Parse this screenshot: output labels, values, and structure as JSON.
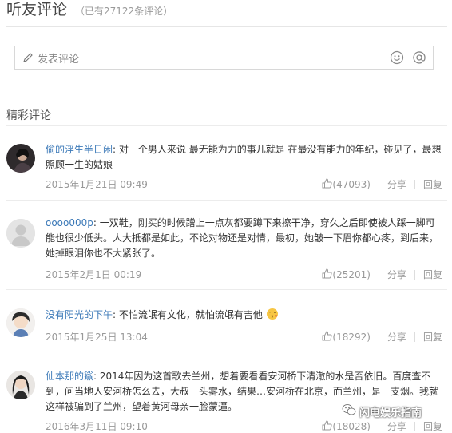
{
  "header": {
    "title": "听友评论",
    "count": "（已有27122条评论）"
  },
  "composer": {
    "placeholder": "发表评论",
    "emoji_icon": "smiley-icon",
    "mention_icon": "at-icon"
  },
  "section": {
    "title": "精彩评论"
  },
  "comments": [
    {
      "user": "偷的浮生半日闲",
      "text": "对一个男人来说 最无能为力的事儿就是 在最没有能力的年纪，碰见了，最想照顾一生的姑娘",
      "date": "2015年1月21日 09:49",
      "likes": "(47093)",
      "share": "分享",
      "reply": "回复"
    },
    {
      "user": "oooo000p",
      "text": "一双鞋，刚买的时候蹭上一点灰都要蹲下来擦干净，穿久之后即使被人踩一脚可能也很少低头。人大抵都是如此，不论对物还是对情，最初，她皱一下眉你都心疼，到后来，她掉眼泪你也不大紧张了。",
      "date": "2015年2月1日 00:19",
      "likes": "(25201)",
      "share": "分享",
      "reply": "回复"
    },
    {
      "user": "没有阳光的下午",
      "text": "不怕流氓有文化，就怕流氓有吉他",
      "date": "2015年1月25日 13:04",
      "likes": "(18292)",
      "share": "分享",
      "reply": "回复"
    },
    {
      "user": "仙本那的鯊",
      "text": "2014年因为这首歌去兰州，想着要看看安河桥下清澈的水是否依旧。百度查不到，问当地人安河桥怎么去，大叔一头雾水，结果…安河桥在北京，而兰州，是一支烟。我就这样被骗到了兰州，望着黄河母亲一脸蒙逼。",
      "date": "2016年3月11日 09:10",
      "likes": "(18028)",
      "share": "分享",
      "reply": "回复"
    }
  ],
  "watermark": {
    "text": "闪电娱乐指南"
  },
  "colors": {
    "username": "#3d7ab8",
    "meta": "#999999",
    "divider": "#ececec"
  }
}
